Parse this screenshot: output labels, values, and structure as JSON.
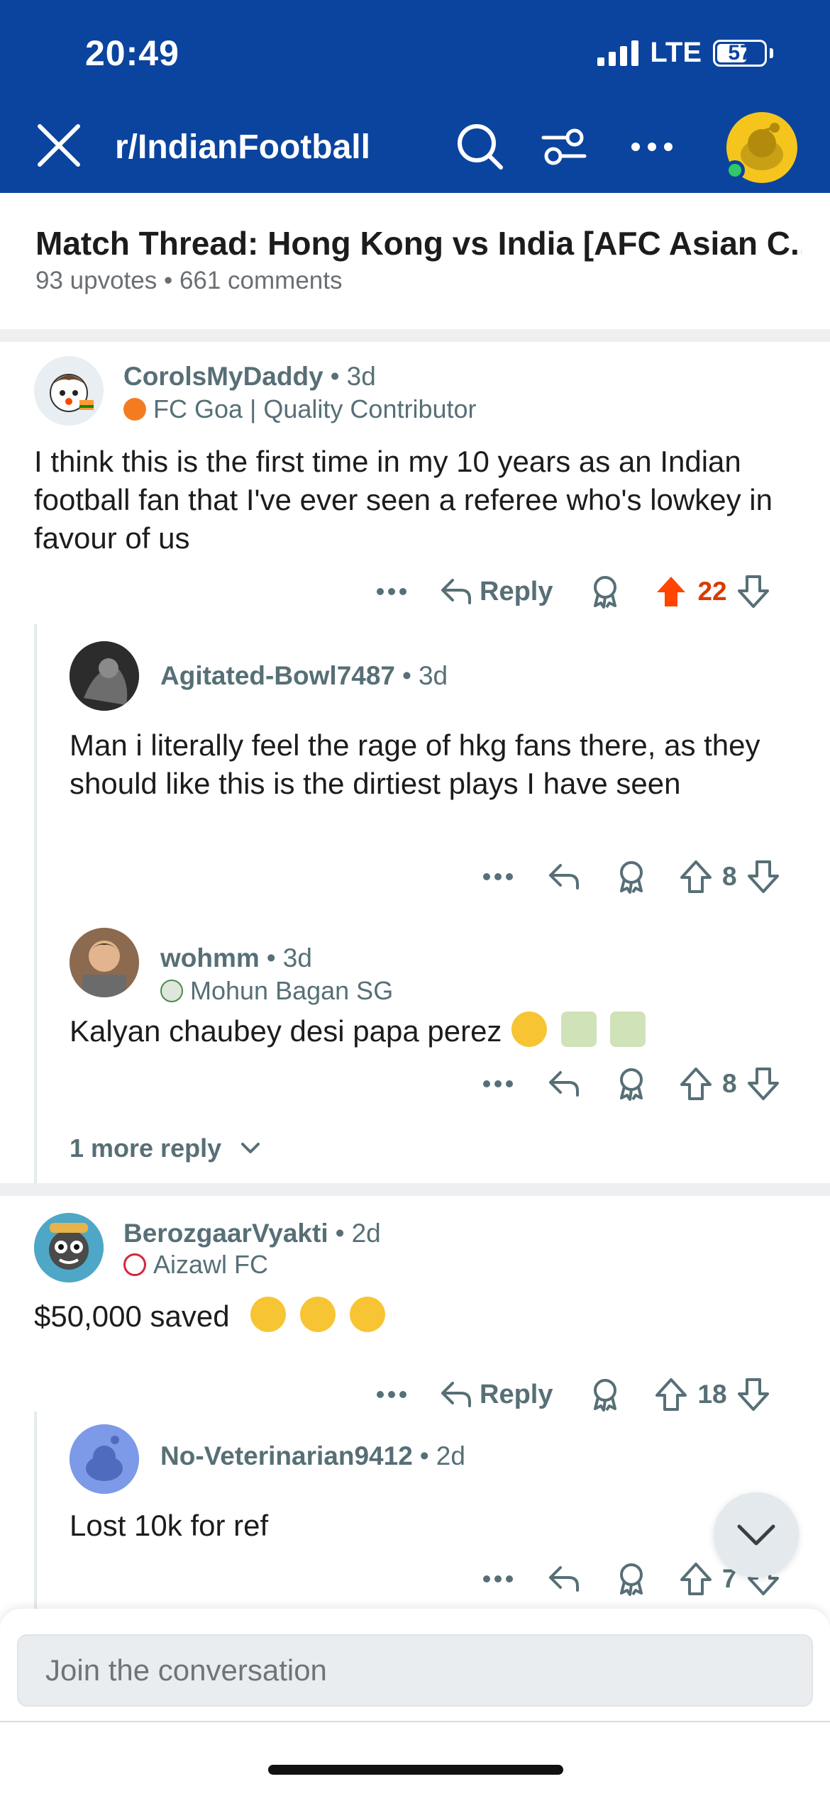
{
  "status_bar": {
    "time": "20:49",
    "network": "LTE",
    "battery": "57"
  },
  "nav": {
    "subreddit": "r/IndianFootball"
  },
  "post": {
    "title": "Match Thread: Hong Kong vs India [AFC Asian C...",
    "meta": "93 upvotes • 661 comments"
  },
  "comments": [
    {
      "username": "CorolsMyDaddy",
      "age": "3d",
      "flair": "FC Goa | Quality Contributor",
      "body": "I think this is the first time in my 10 years as an Indian football fan that I've ever seen a referee who's lowkey in favour of us",
      "reply_label": "Reply",
      "votes": "22",
      "upvoted": true
    },
    {
      "username": "Agitated-Bowl7487",
      "age": "3d",
      "body": "Man i literally feel the rage of hkg fans there, as they should like this is the dirtiest plays I have seen",
      "votes": "8"
    },
    {
      "username": "wohmm",
      "age": "3d",
      "flair": "Mohun Bagan SG",
      "body": "Kalyan chaubey desi papa perez",
      "votes": "8"
    },
    {
      "username": "BerozgaarVyakti",
      "age": "2d",
      "flair": "Aizawl FC",
      "body": "$50,000 saved",
      "reply_label": "Reply",
      "votes": "18"
    },
    {
      "username": "No-Veterinarian9412",
      "age": "2d",
      "body": "Lost 10k for ref",
      "votes": "7"
    }
  ],
  "more_replies_label": "1 more reply",
  "separator": "•",
  "composer": {
    "placeholder": "Join the conversation"
  },
  "colors": {
    "header_bg": "#0b449e",
    "upvote_active": "#d93a00",
    "meta_text": "#576f76"
  }
}
